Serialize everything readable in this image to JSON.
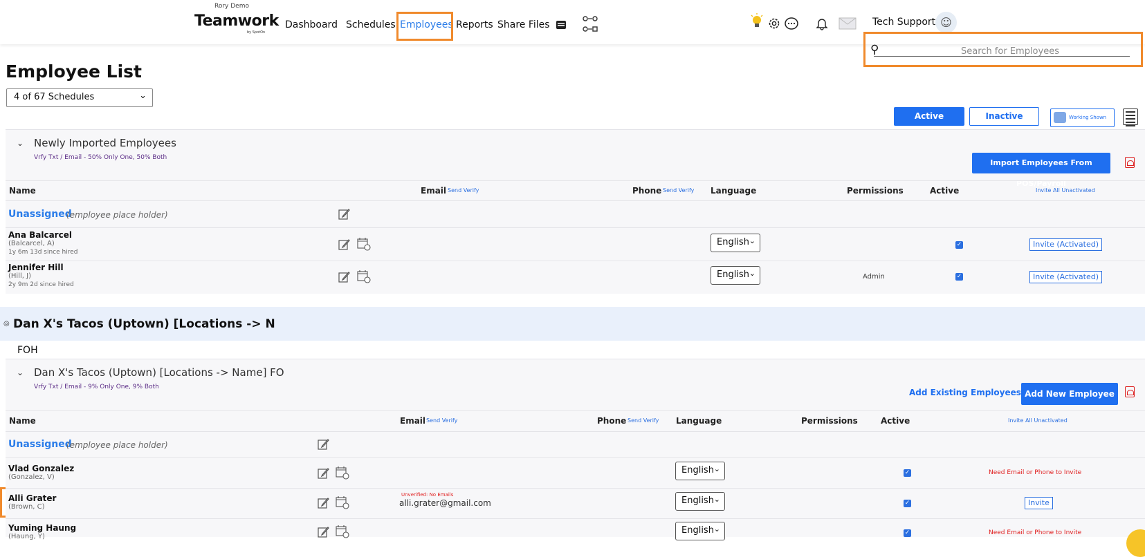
{
  "header": {
    "brand_sub": "Rory Demo",
    "brand": "Teamwork",
    "brand_by": "by SpotOn",
    "nav": [
      "Dashboard",
      "Schedules",
      "Employees",
      "Reports",
      "Share Files"
    ],
    "active_nav": "Employees",
    "user_name": "Tech Support",
    "search_placeholder": "Search for Employees",
    "icons": [
      "printer-icon",
      "workflow-icon",
      "lightbulb-icon",
      "gear-icon",
      "chat-icon",
      "bell-icon",
      "mail-icon",
      "avatar-icon"
    ]
  },
  "page": {
    "title": "Employee List",
    "schedule_select": "4 of 67 Schedules",
    "active_button": "Active",
    "inactive_button": "Inactive",
    "working_shown_button": "Working Shown"
  },
  "section1": {
    "title": "Newly Imported Employees",
    "subtitle": "Vrfy Txt / Email - 50% Only One, 50% Both",
    "import_button": "Import Employees From POS/Payroll",
    "headers": {
      "name": "Name",
      "email": "Email",
      "email_link": "Send Verify",
      "phone": "Phone",
      "phone_link": "Send Verify",
      "language": "Language",
      "permissions": "Permissions",
      "active": "Active",
      "invite_all": "Invite All Unactivated"
    },
    "unassigned": "Unassigned",
    "placeholder_note": "(employee place holder)",
    "rows": [
      {
        "name": "Ana Balcarcel",
        "alias": "(Balcarcel, A)",
        "hired": "1y 6m 13d since hired",
        "language": "English",
        "permissions": "",
        "invite": "Invite (Activated)"
      },
      {
        "name": "Jennifer Hill",
        "alias": "(Hill, J)",
        "hired": "2y 9m 2d since hired",
        "language": "English",
        "permissions": "Admin",
        "invite": "Invite (Activated)"
      }
    ]
  },
  "location": {
    "title": "Dan X's Tacos (Uptown) [Locations -> N",
    "group": "FOH"
  },
  "section2": {
    "title": "Dan X's Tacos (Uptown) [Locations -> Name] FO",
    "subtitle": "Vrfy Txt / Email - 9% Only One, 9% Both",
    "add_existing": "Add Existing Employees",
    "add_new": "Add New Employee",
    "headers": {
      "name": "Name",
      "email": "Email",
      "email_link": "Send Verify",
      "phone": "Phone",
      "phone_link": "Send Verify",
      "language": "Language",
      "permissions": "Permissions",
      "active": "Active",
      "invite_all": "Invite All Unactivated"
    },
    "unassigned": "Unassigned",
    "placeholder_note": "(employee place holder)",
    "rows": [
      {
        "name": "Vlad Gonzalez",
        "alias": "(Gonzalez, V)",
        "language": "English",
        "status": "Need Email or Phone to Invite"
      },
      {
        "name": "Alli Grater",
        "alias": "(Brown, C)",
        "unverified": "Unverified: No Emails",
        "email": "alli.grater@gmail.com",
        "language": "English",
        "invite": "Invite"
      },
      {
        "name": "Yuming Haung",
        "alias": "(Haung, Y)",
        "language": "English",
        "status": "Need Email or Phone to Invite"
      }
    ]
  },
  "colors": {
    "accent": "#1f6ff0",
    "highlight": "#f08a2c",
    "error": "#e02020",
    "sub_purple": "#5b2c86"
  }
}
